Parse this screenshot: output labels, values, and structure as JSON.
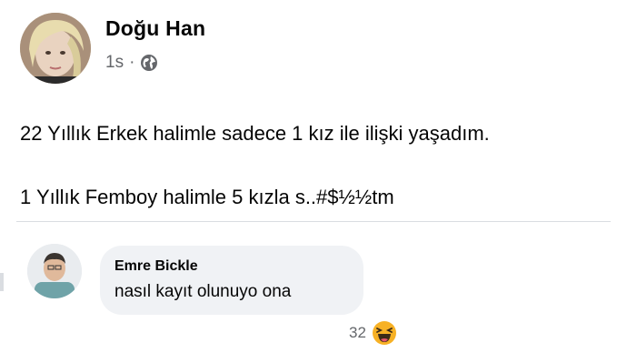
{
  "post": {
    "author": "Doğu Han",
    "time": "1s",
    "separator": "·",
    "privacy_icon": "globe-icon",
    "lines": [
      "22 Yıllık Erkek halimle sadece 1 kız ile ilişki yaşadım.",
      "1 Yıllık Femboy halimle 5 kızla s..#$½½tm"
    ]
  },
  "comment": {
    "author": "Emre Bickle",
    "text": "nasıl kayıt olunuyo ona",
    "reaction_count": "32",
    "reaction_icon": "haha-emoji-icon"
  },
  "colors": {
    "text": "#050505",
    "meta": "#65676b",
    "bubble": "#f0f2f5",
    "divider": "#dadde1",
    "haha": "#f7b125"
  }
}
